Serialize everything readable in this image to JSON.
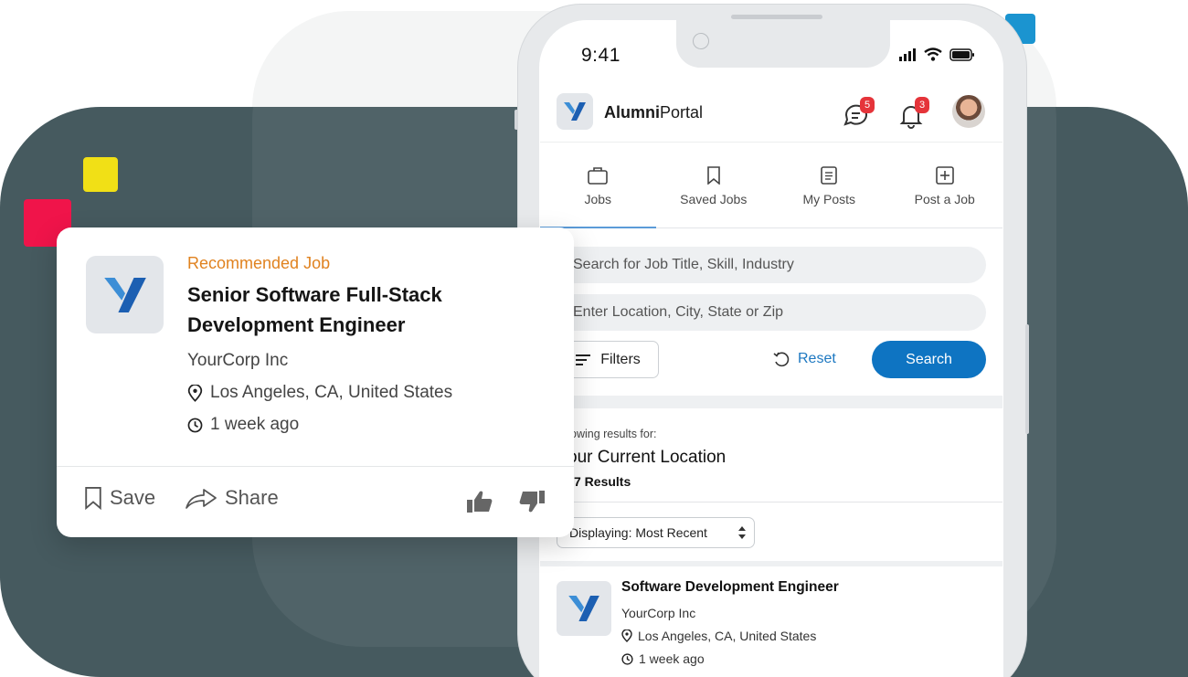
{
  "colors": {
    "background_panel": "#465a5f",
    "accent_yellow": "#f1e016",
    "accent_red": "#f0144a",
    "accent_blue": "#1b94d0",
    "primary_button": "#0e74c2",
    "recommended_label": "#e0821f",
    "badge_red": "#e5343a"
  },
  "phone": {
    "status_bar": {
      "time": "9:41",
      "icons": [
        "signal-icon",
        "wifi-icon",
        "battery-icon"
      ]
    },
    "header": {
      "app_name_bold": "Alumni",
      "app_name_regular": "Portal",
      "messages_badge": "5",
      "notifications_badge": "3"
    },
    "tabs": [
      {
        "label": "Jobs",
        "icon": "briefcase-icon",
        "active": true
      },
      {
        "label": "Saved Jobs",
        "icon": "bookmark-icon",
        "active": false
      },
      {
        "label": "My Posts",
        "icon": "document-icon",
        "active": false
      },
      {
        "label": "Post a Job",
        "icon": "plus-square-icon",
        "active": false
      }
    ],
    "search": {
      "keyword_placeholder": "Search for Job Title,  Skill, Industry",
      "location_placeholder": "Enter Location, City, State or Zip",
      "filters_label": "Filters",
      "reset_label": "Reset",
      "search_label": "Search"
    },
    "results": {
      "showing_label": "owing results for:",
      "location": "our Current Location",
      "count": "7 Results",
      "sort_value": "Displaying: Most Recent"
    },
    "job_listing": {
      "title": "Software Development Engineer",
      "company": "YourCorp Inc",
      "location": "Los Angeles, CA, United States",
      "posted": "1 week ago"
    }
  },
  "recommended_card": {
    "eyebrow": "Recommended Job",
    "title": "Senior Software Full-Stack Development Engineer",
    "company": "YourCorp Inc",
    "location": "Los Angeles, CA, United States",
    "posted": "1 week ago",
    "save_label": "Save",
    "share_label": "Share"
  }
}
